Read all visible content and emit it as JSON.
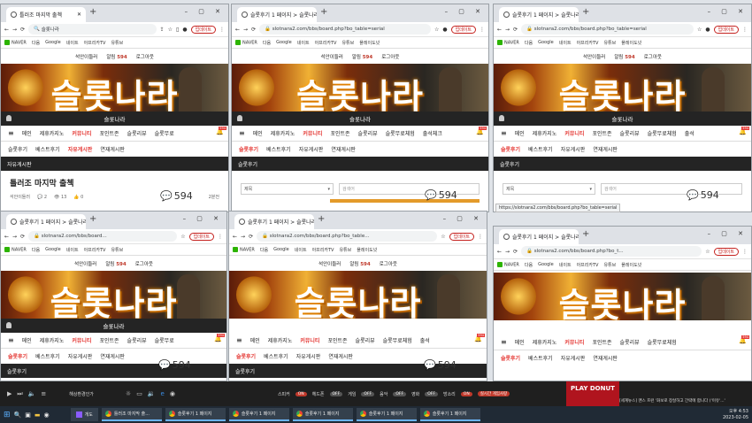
{
  "site": {
    "title": "슬롯나라",
    "logo_text": "슬롯나라",
    "username": "석안이들러",
    "points_label": "알림",
    "points_value": "594",
    "logout": "로그아웃",
    "nav": [
      "메인",
      "제휴카지노",
      "커뮤니티",
      "포인트존",
      "슬롯리뷰",
      "슬롯무료체험",
      "출석체크"
    ],
    "nav_short": [
      "메인",
      "제휴카지노",
      "커뮤니티",
      "포인트존",
      "슬롯리뷰",
      "슬롯무료"
    ],
    "nav_short2": [
      "메인",
      "제휴카지노",
      "커뮤니티",
      "포인트존",
      "슬롯리뷰",
      "슬롯무료체험",
      "출석"
    ],
    "bell_count": "594",
    "sub_free": [
      "슬롯후기",
      "베스트후기",
      "자유게시판",
      "연재게시판"
    ],
    "badge_594": "594"
  },
  "windows": [
    {
      "tab": "틀러조 마지막 출첵",
      "url": "슬롯나라",
      "section": "자유게시판",
      "post_title": "틀러조 마지막 출첵",
      "author": "석안이들러",
      "comments": "2",
      "views": "13",
      "likes": "0",
      "date": "2분전"
    },
    {
      "tab": "슬롯후기 1 페이지 > 슬롯나라",
      "url": "slotnara2.com/bbs/board.php?bo_table=serial",
      "section": "슬롯후기",
      "select_label": "제목",
      "search_placeholder": "검색어"
    },
    {
      "tab": "슬롯후기 1 페이지 > 슬롯나라",
      "url": "slotnara2.com/bbs/board.php?bo_table=serial",
      "section": "슬롯후기",
      "select_label": "제목",
      "search_placeholder": "검색어"
    },
    {
      "tab": "슬롯후기 1 페이지 > 슬롯나라",
      "url": "slotnara2.com/bbs/board...",
      "section": "슬롯후기"
    },
    {
      "tab": "슬롯후기 1 페이지 > 슬롯나라",
      "url": "slotnara2.com/bbs/board.php?bo_table...",
      "section": "슬롯후기"
    },
    {
      "tab": "슬롯후기 1 페이지 > 슬롯나라",
      "url": "slotnara2.com/bbs/board.php?bo_t...",
      "section": "슬롯후기"
    }
  ],
  "browser": {
    "ext_pill": "업데이트",
    "bookmarks": [
      "NAVER",
      "다음",
      "Google",
      "네이트",
      "아프리카TV",
      "유튜브",
      "플레이도넛"
    ]
  },
  "tooltip": "https://slotnara2.com/bbs/board.php?bo_table=serial",
  "media_bar": {
    "labels": [
      "해상환경인가",
      "스피커",
      "헤드폰",
      "게임",
      "음악",
      "영화",
      "방소리",
      "실시간 게임사랑"
    ],
    "state_on": "ON",
    "state_off": "OFF",
    "ad_text": "PLAY DONUT"
  },
  "news_ticker": "[세계뉴스] 맨스 프런 '화보로 창살하고 간략에 합니다 ('이유'...'",
  "taskbar": {
    "start": "⊞",
    "search": "🔍",
    "app_label": "개도",
    "buttons": [
      "틀러조 마지막 출...",
      "슬롯후기 1 페이지",
      "슬롯후기 1 페이지",
      "슬롯후기 1 페이지",
      "슬롯후기 1 페이지",
      "슬롯후기 1 페이지"
    ],
    "time": "오후 4:53",
    "date": "2023-02-05"
  }
}
